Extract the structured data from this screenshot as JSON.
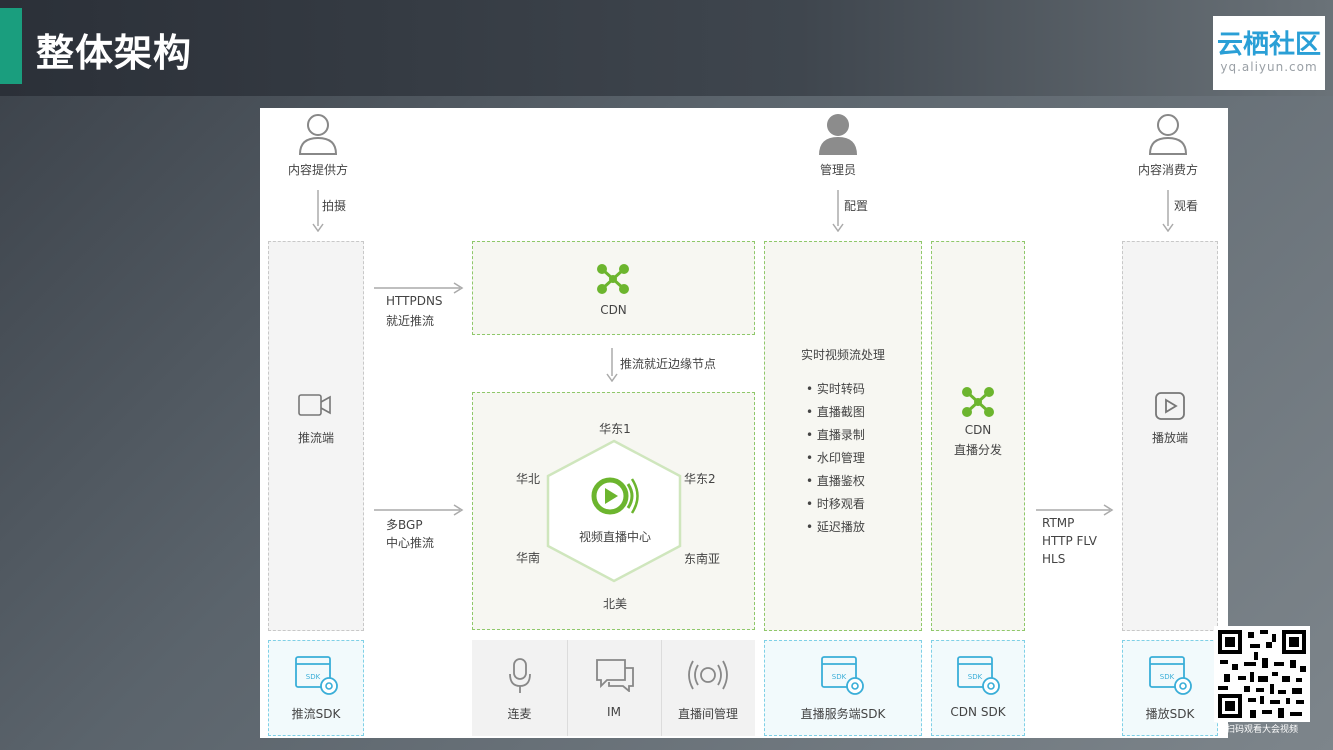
{
  "slide": {
    "title": "整体架构",
    "logo_main": "云栖社区",
    "logo_url": "yq.aliyun.com",
    "qr_caption": "扫码观看大会视频"
  },
  "actors": {
    "provider": {
      "label": "内容提供方",
      "action": "拍摄"
    },
    "admin": {
      "label": "管理员",
      "action": "配置"
    },
    "consumer": {
      "label": "内容消费方",
      "action": "观看"
    }
  },
  "left": {
    "push_client": "推流端",
    "push_sdk": "推流SDK"
  },
  "arrows": {
    "upper": [
      "HTTPDNS",
      "就近推流"
    ],
    "lower": [
      "多BGP",
      "中心推流"
    ],
    "edge": "推流就近边缘节点",
    "out": [
      "RTMP",
      "HTTP FLV",
      "HLS"
    ]
  },
  "cdn_top": {
    "label": "CDN"
  },
  "center": {
    "title": "视频直播中心",
    "regions": [
      "华东1",
      "华东2",
      "东南亚",
      "北美",
      "华南",
      "华北"
    ]
  },
  "bottom_tools": [
    "连麦",
    "IM",
    "直播间管理"
  ],
  "processing": {
    "title": "实时视频流处理",
    "items": [
      "实时转码",
      "直播截图",
      "直播录制",
      "水印管理",
      "直播鉴权",
      "时移观看",
      "延迟播放"
    ],
    "sdk": "直播服务端SDK"
  },
  "cdn_dist": {
    "label1": "CDN",
    "label2": "直播分发",
    "sdk": "CDN SDK"
  },
  "right": {
    "player": "播放端",
    "player_sdk": "播放SDK"
  },
  "colors": {
    "green": "#6cb52e",
    "accent": "#1a9e7e",
    "blue_icon": "#3aaed8",
    "logo": "#2a9fd6"
  }
}
